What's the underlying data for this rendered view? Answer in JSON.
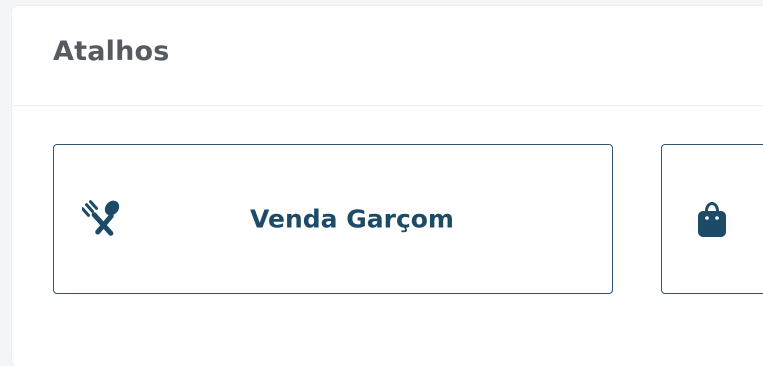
{
  "panel": {
    "title": "Atalhos"
  },
  "shortcuts": [
    {
      "label": "Venda Garçom",
      "icon": "utensils-icon"
    },
    {
      "label": "",
      "icon": "shopping-bag-icon"
    }
  ],
  "colors": {
    "accent": "#1d4a66",
    "border": "#2f5671",
    "title": "#555b61"
  }
}
